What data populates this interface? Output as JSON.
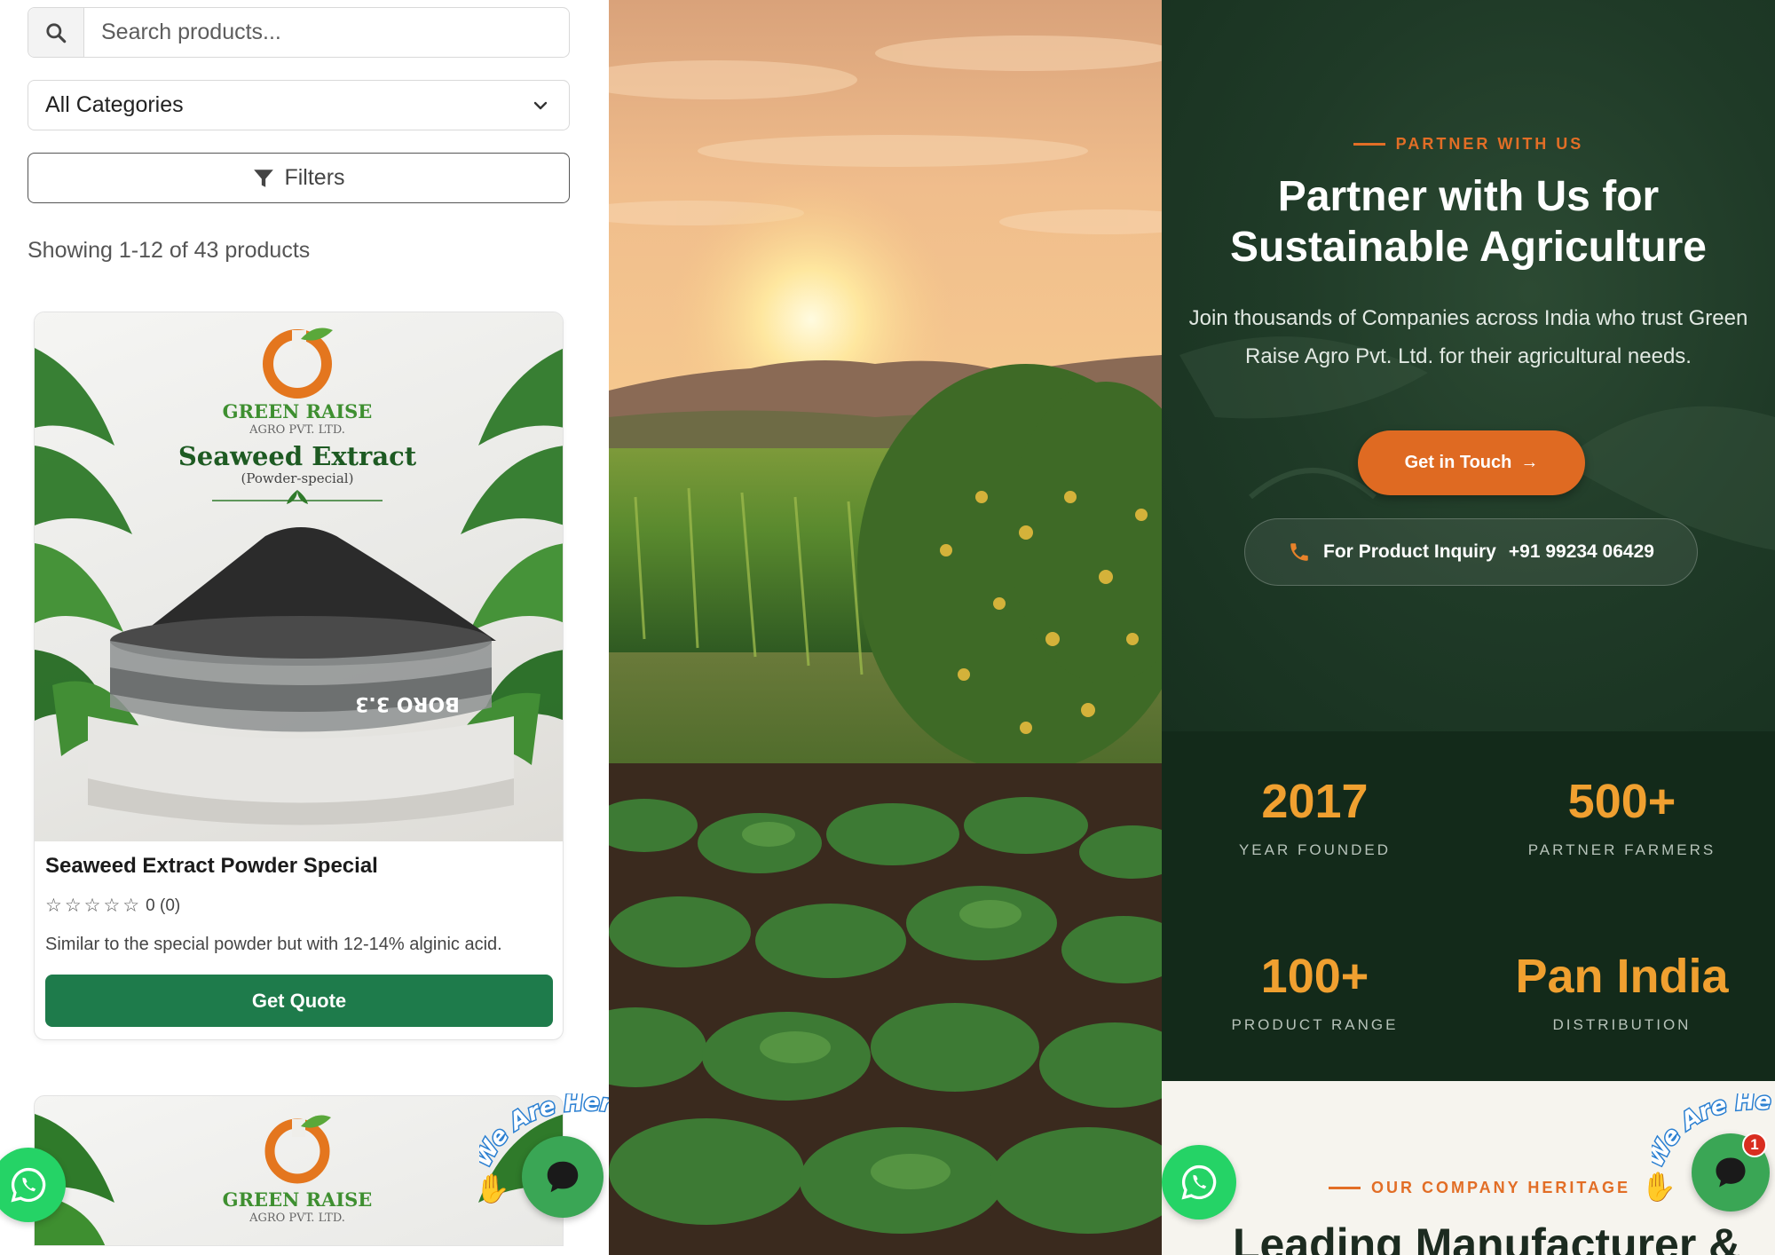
{
  "product_list": {
    "search": {
      "placeholder": "Search products...",
      "value": ""
    },
    "category_select": {
      "selected": "All Categories"
    },
    "filters_label": "Filters",
    "showing_text": "Showing 1-12 of 43 products",
    "products": [
      {
        "image_brand": "GREEN RAISE",
        "image_brand_sub": "AGRO PVT. LTD.",
        "image_title": "Seaweed Extract",
        "image_subtitle": "(Powder-special)",
        "image_jar_label": "BORO 3.3",
        "name": "Seaweed Extract Powder Special",
        "rating_text": "0 (0)",
        "stars": 0,
        "description": "Similar to the special powder but with 12-14% alginic acid.",
        "button": "Get Quote"
      },
      {
        "image_brand": "GREEN RAISE",
        "image_brand_sub": "AGRO PVT. LTD."
      }
    ]
  },
  "widgets": {
    "chat_tagline": "We Are Here",
    "chat_badge_count": "1"
  },
  "partner_section": {
    "eyebrow": "PARTNER WITH US",
    "heading_line1": "Partner with Us for",
    "heading_line2": "Sustainable Agriculture",
    "description": "Join thousands of Companies across India who trust Green Raise Agro Pvt. Ltd. for their agricultural needs.",
    "cta_label": "Get in Touch",
    "inquiry_label": "For Product Inquiry",
    "inquiry_phone": "+91 99234 06429"
  },
  "stats": [
    {
      "value": "2017",
      "label": "YEAR FOUNDED"
    },
    {
      "value": "500+",
      "label": "PARTNER FARMERS"
    },
    {
      "value": "100+",
      "label": "PRODUCT RANGE"
    },
    {
      "value": "Pan India",
      "label": "DISTRIBUTION"
    }
  ],
  "heritage": {
    "eyebrow": "OUR COMPANY HERITAGE",
    "heading_partial": "Leading Manufacturer &"
  },
  "colors": {
    "brand_green": "#1e7b4b",
    "accent_orange": "#df6a22",
    "stat_gold": "#f0a030",
    "dark_green": "#132a1a",
    "whatsapp": "#25d366"
  }
}
